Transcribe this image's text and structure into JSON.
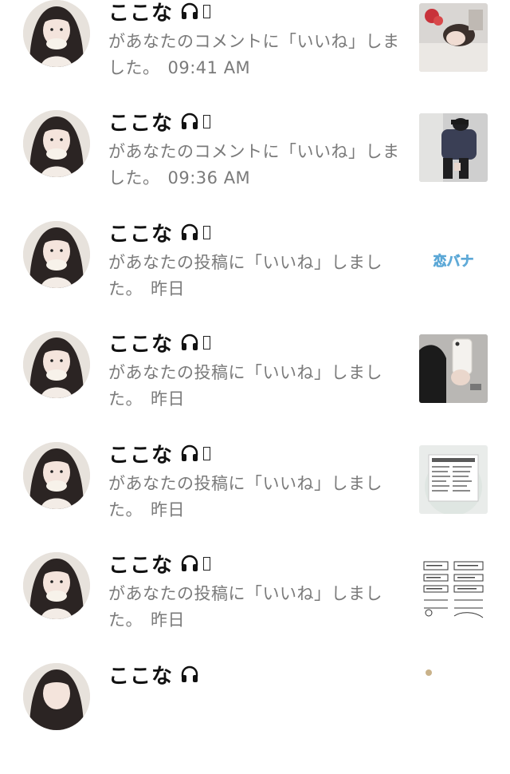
{
  "notifications": [
    {
      "user": "ここな",
      "message": "があなたのコメントに「いいね」しました。",
      "time": "09:41 AM",
      "thumb": "photo-girl-lying"
    },
    {
      "user": "ここな",
      "message": "があなたのコメントに「いいね」しました。",
      "time": "09:36 AM",
      "thumb": "photo-cap-hoodie"
    },
    {
      "user": "ここな",
      "message": "があなたの投稿に「いいね」しました。",
      "time": "昨日",
      "thumb": "text-koibana",
      "thumb_text": "恋バナ"
    },
    {
      "user": "ここな",
      "message": "があなたの投稿に「いいね」しました。",
      "time": "昨日",
      "thumb": "photo-mirror-selfie"
    },
    {
      "user": "ここな",
      "message": "があなたの投稿に「いいね」しました。",
      "time": "昨日",
      "thumb": "screenshot-list"
    },
    {
      "user": "ここな",
      "message": "があなたの投稿に「いいね」しました。",
      "time": "昨日",
      "thumb": "handwritten-notes"
    },
    {
      "user": "ここな",
      "message": "",
      "time": "",
      "thumb": "partial"
    }
  ]
}
